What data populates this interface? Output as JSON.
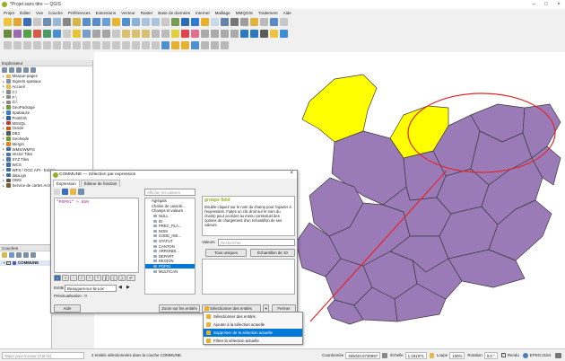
{
  "app": {
    "title": "*Projet sans titre — QGIS"
  },
  "menu": [
    "Projet",
    "Éditer",
    "Vue",
    "Couche",
    "Préférences",
    "Extensions",
    "Vecteur",
    "Raster",
    "Base de données",
    "Internet",
    "Maillage",
    "MMQGIS",
    "Traitement",
    "Aide"
  ],
  "explorer": {
    "title": "Explorateur",
    "items": [
      {
        "label": "Marque-pages",
        "color": "#e8b84a"
      },
      {
        "label": "Signets spatiaux",
        "color": "#7f93a8"
      },
      {
        "label": "Accueil",
        "color": "#e8b84a"
      },
      {
        "label": "C:\\",
        "color": "#8a8a8a"
      },
      {
        "label": "F:\\",
        "color": "#8a8a8a"
      },
      {
        "label": "G:\\",
        "color": "#8a8a8a"
      },
      {
        "label": "GeoPackage",
        "color": "#6c9a3c"
      },
      {
        "label": "SpatiaLite",
        "color": "#3b7fc4"
      },
      {
        "label": "PostGIS",
        "color": "#2a5f9e"
      },
      {
        "label": "MSSQL",
        "color": "#c0392b"
      },
      {
        "label": "Oracle",
        "color": "#d35400"
      },
      {
        "label": "DB2",
        "color": "#555555"
      },
      {
        "label": "GeoNode",
        "color": "#6a9f2b"
      },
      {
        "label": "Mergin",
        "color": "#e67e22"
      },
      {
        "label": "WMS/WMTS",
        "color": "#3a6ea5"
      },
      {
        "label": "Vector Tiles",
        "color": "#4a76a8"
      },
      {
        "label": "XYZ Tiles",
        "color": "#4a76a8"
      },
      {
        "label": "WCS",
        "color": "#3a6ea5"
      },
      {
        "label": "WFS / OGC API - Entités",
        "color": "#3a6ea5"
      },
      {
        "label": "data.ign",
        "color": "#3a6ea5"
      },
      {
        "label": "OWS",
        "color": "#555555"
      },
      {
        "label": "Service de cartes ArcGIS Rest",
        "color": "#7a5c2e"
      }
    ]
  },
  "layers": {
    "title": "Couches",
    "layer_name": "COMMUNE"
  },
  "dialog": {
    "title": "COMMUNE — Sélection par expression",
    "tabs": [
      "Expression",
      "Éditeur de fonction"
    ],
    "expression": "\"POP01\" > 850",
    "search_placeholder": "Afficher les valeurs",
    "functions": [
      "Agrégats",
      "Chaîne de caractè...",
      "Champs et valeurs",
      "NULL",
      "ID",
      "PREC_PLA...",
      "NOM",
      "CODE_INS...",
      "STATUT",
      "CANTON",
      "ARRONDI...",
      "DEPART",
      "REGION",
      "POP01",
      "MULTICAN"
    ],
    "help_title": "groupe field",
    "help_text": "Double-cliquez sur le nom du champ pour l'ajouter à l'expression. Faites un clic droit sur le nom du champ pour accéder au menu contextuel des options de chargement d'un échantillon de ses valeurs.",
    "values_label": "Valeurs",
    "values_search": "Rechercher",
    "btn_all": "Tous uniques",
    "btn_sample": "Échantillon de 10",
    "entity_label": "Entité",
    "entity_value": "Beaugues-sur-la-Loir",
    "preview_label": "Prévisualisation : 0",
    "btn_help": "Aide",
    "btn_zoom": "Zoom sur les entités",
    "btn_select": "Sélectionner des entités",
    "btn_close": "Fermer"
  },
  "dropdown": {
    "items": [
      "Sélectionner des entités",
      "Ajouter à la sélection actuelle",
      "Supprimer de la sélection actuelle",
      "Filtrer la sélection actuelle"
    ],
    "highlighted": 2
  },
  "status": {
    "search_placeholder": "Taper pour trouver (Ctrl+K)",
    "message": "2 entités sélectionnées dans la couche COMMUNE.",
    "coord_label": "Coordonnée",
    "coord": "455020,6730997",
    "scale_label": "Échelle",
    "scale": "1:181871",
    "magnifier_label": "Loupe",
    "magnifier": "100%",
    "rotation_label": "Rotation",
    "rotation": "0,0 °",
    "render_label": "Rendu",
    "crs": "EPSG:2154"
  },
  "colors": {
    "selected": "#ffff00",
    "polygon": "#9b7bb7",
    "annotation": "#e0262b"
  }
}
